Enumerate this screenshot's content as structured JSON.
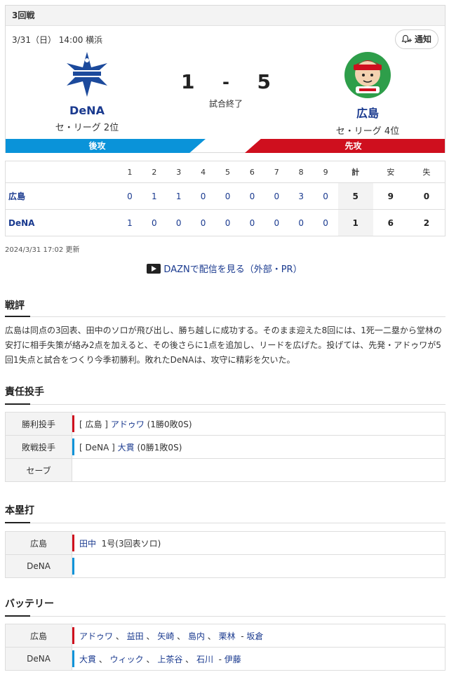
{
  "game": {
    "round": "3回戦",
    "meta": "3/31（日） 14:00 横浜",
    "notify_label": "通知",
    "home": {
      "name": "DeNA",
      "league": "セ・リーグ 2位",
      "batting": "後攻",
      "color": "#0a93d9"
    },
    "away": {
      "name": "広島",
      "league": "セ・リーグ 4位",
      "batting": "先攻",
      "color": "#cf0f1e"
    },
    "score_home": "1",
    "score_sep": "-",
    "score_away": "5",
    "status": "試合終了"
  },
  "scoreboard": {
    "headers": [
      "1",
      "2",
      "3",
      "4",
      "5",
      "6",
      "7",
      "8",
      "9",
      "計",
      "安",
      "失"
    ],
    "rows": [
      {
        "team": "広島",
        "innings": [
          "0",
          "1",
          "1",
          "0",
          "0",
          "0",
          "0",
          "3",
          "0"
        ],
        "total": "5",
        "hits": "9",
        "errors": "0"
      },
      {
        "team": "DeNA",
        "innings": [
          "1",
          "0",
          "0",
          "0",
          "0",
          "0",
          "0",
          "0",
          "0"
        ],
        "total": "1",
        "hits": "6",
        "errors": "2"
      }
    ]
  },
  "updated": "2024/3/31 17:02 更新",
  "dazn_link": "DAZNで配信を見る（外部・PR）",
  "review": {
    "title": "戦評",
    "text": "広島は同点の3回表、田中のソロが飛び出し、勝ち越しに成功する。そのまま迎えた8回には、1死一二塁から堂林の安打に相手失策が絡み2点を加えると、その後さらに1点を追加し、リードを広げた。投げては、先発・アドゥワが5回1失点と試合をつくり今季初勝利。敗れたDeNAは、攻守に精彩を欠いた。"
  },
  "pitchers": {
    "title": "責任投手",
    "win": {
      "label": "勝利投手",
      "team": "[ 広島 ]",
      "name": "アドゥワ",
      "record": "(1勝0敗0S)"
    },
    "loss": {
      "label": "敗戦投手",
      "team": "[ DeNA ]",
      "name": "大貫",
      "record": "(0勝1敗0S)"
    },
    "save": {
      "label": "セーブ"
    }
  },
  "homeruns": {
    "title": "本塁打",
    "away_team": "広島",
    "away_player": "田中",
    "away_detail": "1号(3回表ソロ)",
    "home_team": "DeNA"
  },
  "battery": {
    "title": "バッテリー",
    "away_team": "広島",
    "away_players": [
      "アドゥワ",
      "益田",
      "矢崎",
      "島内",
      "栗林"
    ],
    "away_catcher": "坂倉",
    "home_team": "DeNA",
    "home_players": [
      "大貫",
      "ウィック",
      "上茶谷",
      "石川"
    ],
    "home_catcher": "伊藤"
  }
}
